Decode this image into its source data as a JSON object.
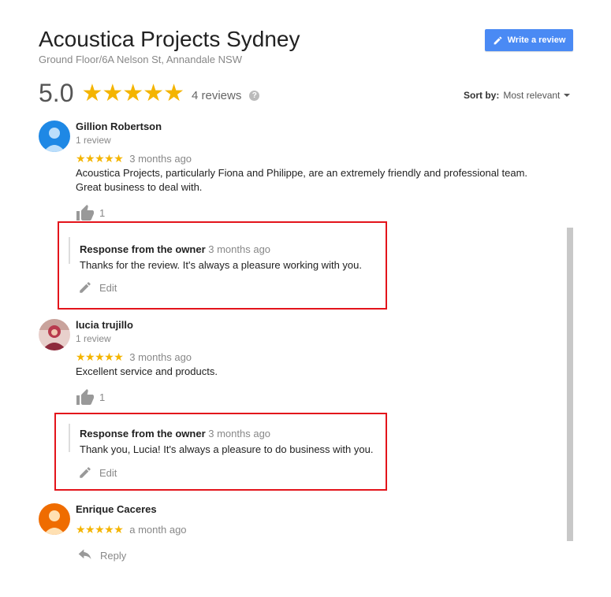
{
  "header": {
    "business_name": "Acoustica Projects Sydney",
    "address": "Ground Floor/6A Nelson St, Annandale NSW",
    "write_review_label": "Write a review",
    "rating_value": "5.0",
    "rating_stars": "★★★★★",
    "review_count": "4 reviews",
    "help_icon": "?",
    "sort_label": "Sort by:",
    "sort_value": "Most relevant"
  },
  "reviews": [
    {
      "name": "Gillion Robertson",
      "reviews_count": "1 review",
      "stars": "★★★★★",
      "date": "3 months ago",
      "text": "Acoustica Projects, particularly Fiona and Philippe, are an extremely friendly and professional team. Great business to deal with.",
      "likes": "1",
      "avatar_color": "#1e88e5",
      "response": {
        "heading": "Response from the owner",
        "date": "3 months ago",
        "text": "Thanks for the review. It's always a pleasure working with you.",
        "edit_label": "Edit"
      }
    },
    {
      "name": "lucia trujillo",
      "reviews_count": "1 review",
      "stars": "★★★★★",
      "date": "3 months ago",
      "text": "Excellent service and products.",
      "likes": "1",
      "avatar_color": "#8e2a3c",
      "response": {
        "heading": "Response from the owner",
        "date": "3 months ago",
        "text": "Thank you, Lucia! It's always a pleasure to do business with you.",
        "edit_label": "Edit"
      }
    },
    {
      "name": "Enrique Caceres",
      "stars": "★★★★★",
      "date": "a month ago",
      "reply_label": "Reply",
      "avatar_color": "#ef6c00"
    }
  ],
  "icons": {
    "write": "pencil-icon",
    "help": "help-circle-icon",
    "sort": "caret-down-icon",
    "like": "thumbs-up-icon",
    "edit": "pencil-icon",
    "reply": "reply-icon"
  },
  "colors": {
    "accent": "#4a8af4",
    "stars": "#f4b400",
    "highlight_box": "#e3141b",
    "scrollbar": "#c8c8c8"
  }
}
